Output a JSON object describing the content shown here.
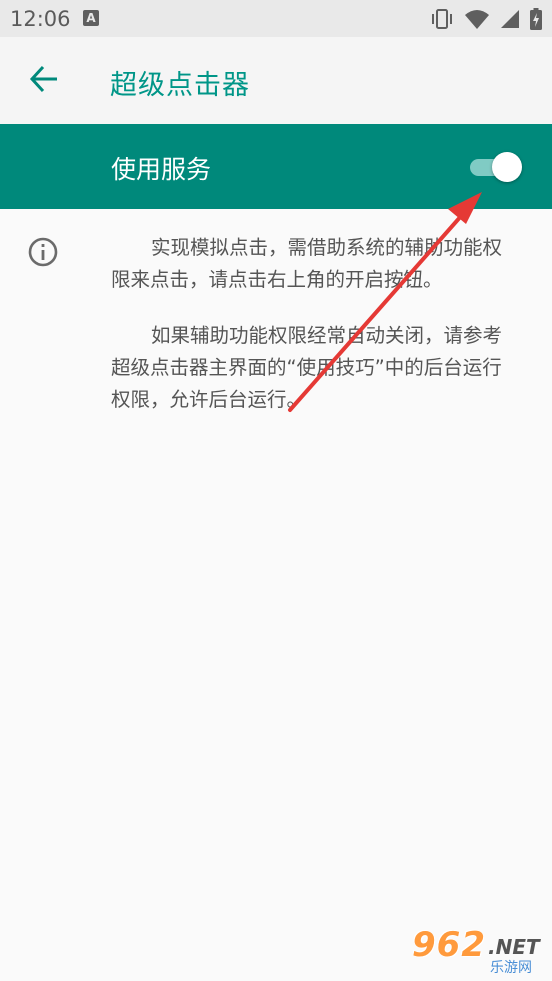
{
  "status_bar": {
    "time": "12:06",
    "notification_icon": "A",
    "icons": [
      "vibrate-icon",
      "wifi-icon",
      "signal-icon",
      "battery-icon"
    ]
  },
  "app_bar": {
    "back_icon": "arrow-left-icon",
    "title": "超级点击器"
  },
  "service_switch": {
    "label": "使用服务",
    "state": "on"
  },
  "info": {
    "icon": "info-icon",
    "paragraph1": "实现模拟点击，需借助系统的辅助功能权限来点击，请点击右上角的开启按钮。",
    "paragraph2": "如果辅助功能权限经常自动关闭，请参考超级点击器主界面的“使用技巧”中的后台运行权限，允许后台运行。"
  },
  "watermark": {
    "number": "962",
    "suffix": ".NET",
    "site_name": "乐游网"
  },
  "colors": {
    "primary": "#00897b",
    "title_teal": "#009688",
    "arrow_red": "#e53935"
  }
}
